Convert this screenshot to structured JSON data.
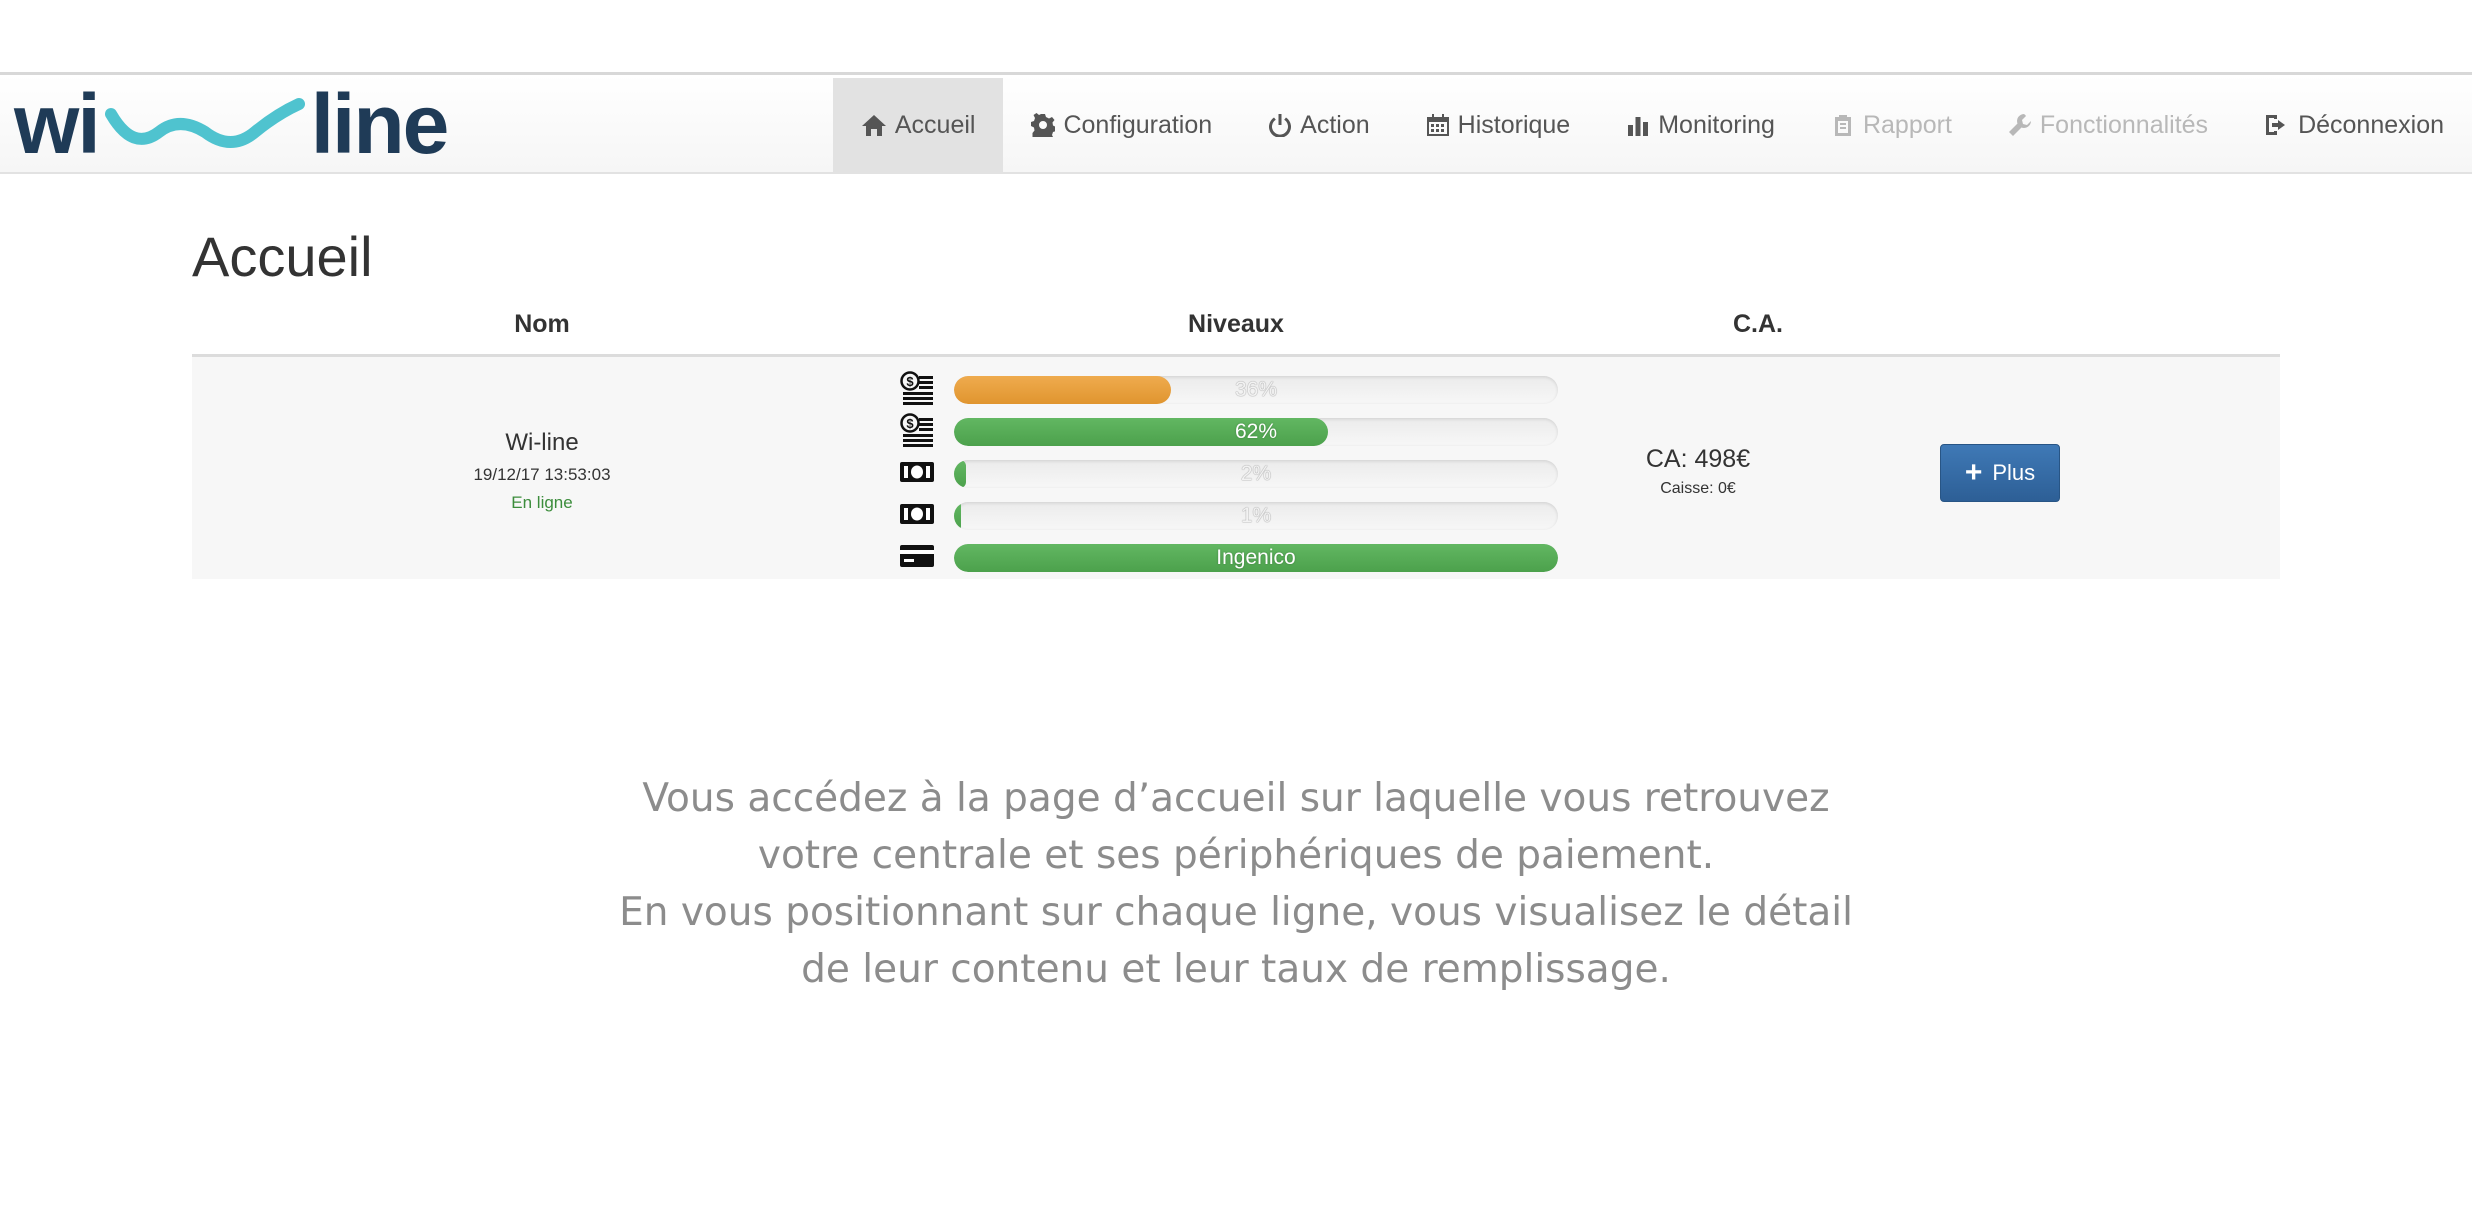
{
  "logo": {
    "left": "wi",
    "right": "line",
    "colors": {
      "text": "#1f3b57",
      "wave": "#4fc3cf"
    }
  },
  "nav": {
    "items": [
      {
        "label": "Accueil",
        "icon": "home-icon",
        "state": "active"
      },
      {
        "label": "Configuration",
        "icon": "gear-icon",
        "state": "normal"
      },
      {
        "label": "Action",
        "icon": "power-icon",
        "state": "normal"
      },
      {
        "label": "Historique",
        "icon": "calendar-icon",
        "state": "normal"
      },
      {
        "label": "Monitoring",
        "icon": "bar-chart-icon",
        "state": "normal"
      },
      {
        "label": "Rapport",
        "icon": "clipboard-icon",
        "state": "disabled"
      },
      {
        "label": "Fonctionnalités",
        "icon": "wrench-icon",
        "state": "disabled"
      },
      {
        "label": "Déconnexion",
        "icon": "logout-icon",
        "state": "normal"
      }
    ]
  },
  "page": {
    "title": "Accueil"
  },
  "table": {
    "headers": {
      "nom": "Nom",
      "niveaux": "Niveaux",
      "ca": "C.A."
    },
    "rows": [
      {
        "name": "Wi-line",
        "datetime": "19/12/17 13:53:03",
        "status": "En ligne",
        "levels": [
          {
            "icon": "coin-stack-icon",
            "label": "36%",
            "value": 0.36,
            "color": "orange"
          },
          {
            "icon": "coin-stack-icon",
            "label": "62%",
            "value": 0.62,
            "color": "green"
          },
          {
            "icon": "banknote-icon",
            "label": "2%",
            "value": 0.02,
            "color": "green"
          },
          {
            "icon": "banknote-icon",
            "label": "1%",
            "value": 0.01,
            "color": "green"
          },
          {
            "icon": "card-icon",
            "label": "Ingenico",
            "value": 1.0,
            "color": "green"
          }
        ],
        "ca": "CA: 498€",
        "caisse": "Caisse: 0€",
        "button_label": "Plus"
      }
    ]
  },
  "caption": {
    "lines": [
      "Vous accédez à la page d’accueil sur laquelle vous retrouvez",
      "votre centrale et ses périphériques de paiement.",
      "En vous positionnant sur chaque ligne, vous visualisez le détail",
      "de leur contenu et leur taux de remplissage."
    ]
  }
}
